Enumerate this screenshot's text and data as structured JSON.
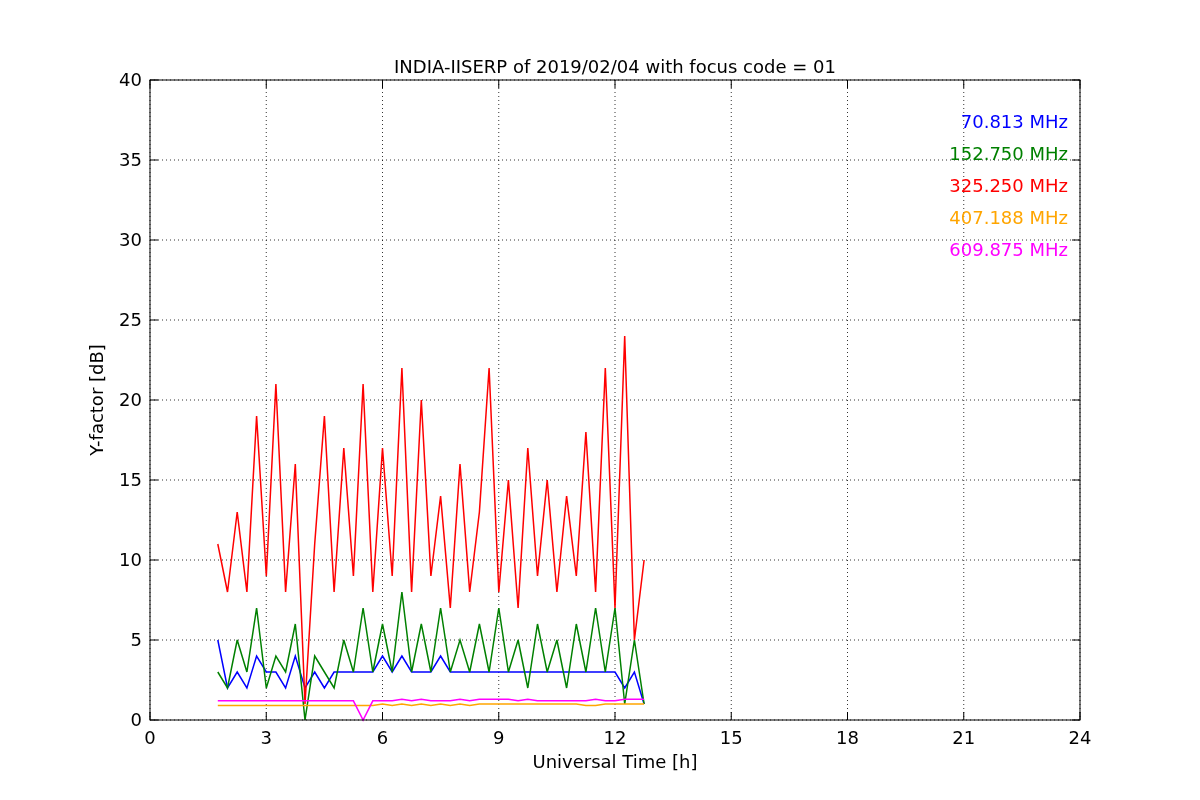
{
  "figure": {
    "chart_data": {
      "type": "line",
      "title": "INDIA-IISERP of 2019/02/04 with focus code = 01",
      "xlabel": "Universal Time [h]",
      "ylabel": "Y-factor [dB]",
      "xlim": [
        0,
        24
      ],
      "ylim": [
        0,
        40
      ],
      "xticks": [
        0,
        3,
        6,
        9,
        12,
        15,
        18,
        21,
        24
      ],
      "yticks": [
        0,
        5,
        10,
        15,
        20,
        25,
        30,
        35,
        40
      ],
      "grid": true,
      "x": [
        1.75,
        2,
        2.25,
        2.5,
        2.75,
        3,
        3.25,
        3.5,
        3.75,
        4,
        4.25,
        4.5,
        4.75,
        5,
        5.25,
        5.5,
        5.75,
        6,
        6.25,
        6.5,
        6.75,
        7,
        7.25,
        7.5,
        7.75,
        8,
        8.25,
        8.5,
        8.75,
        9,
        9.25,
        9.5,
        9.75,
        10,
        10.25,
        10.5,
        10.75,
        11,
        11.25,
        11.5,
        11.75,
        12,
        12.25,
        12.5,
        12.75
      ],
      "series": [
        {
          "name": "70.813 MHz",
          "color": "#0000ff",
          "values": [
            5,
            2,
            3,
            2,
            4,
            3,
            3,
            2,
            4,
            2,
            3,
            2,
            3,
            3,
            3,
            3,
            3,
            4,
            3,
            4,
            3,
            3,
            3,
            4,
            3,
            3,
            3,
            3,
            3,
            3,
            3,
            3,
            3,
            3,
            3,
            3,
            3,
            3,
            3,
            3,
            3,
            3,
            2,
            3,
            1
          ]
        },
        {
          "name": "152.750 MHz",
          "color": "#008000",
          "values": [
            3,
            2,
            5,
            3,
            7,
            2,
            4,
            3,
            6,
            0,
            4,
            3,
            2,
            5,
            3,
            7,
            3,
            6,
            3,
            8,
            3,
            6,
            3,
            7,
            3,
            5,
            3,
            6,
            3,
            7,
            3,
            5,
            2,
            6,
            3,
            5,
            2,
            6,
            3,
            7,
            3,
            7,
            1,
            5,
            1
          ]
        },
        {
          "name": "325.250 MHz",
          "color": "#ff0000",
          "values": [
            11,
            8,
            13,
            8,
            19,
            9,
            21,
            8,
            16,
            1,
            11,
            19,
            8,
            17,
            9,
            21,
            8,
            17,
            9,
            22,
            8,
            20,
            9,
            14,
            7,
            16,
            8,
            13,
            22,
            8,
            15,
            7,
            17,
            9,
            15,
            8,
            14,
            9,
            18,
            8,
            22,
            7,
            24,
            5,
            10
          ]
        },
        {
          "name": "407.188 MHz",
          "color": "#ffa500",
          "values": [
            0.9,
            0.9,
            0.9,
            0.9,
            0.9,
            0.9,
            0.9,
            0.9,
            0.9,
            0.9,
            0.9,
            0.9,
            0.9,
            0.9,
            0.9,
            0.9,
            0.9,
            1,
            0.9,
            1,
            0.9,
            1,
            0.9,
            1,
            0.9,
            1,
            0.9,
            1,
            1,
            1,
            1,
            1,
            1,
            1,
            1,
            1,
            1,
            1,
            0.9,
            0.9,
            1,
            1,
            1,
            1,
            1
          ]
        },
        {
          "name": "609.875 MHz",
          "color": "#ff00ff",
          "values": [
            1.2,
            1.2,
            1.2,
            1.2,
            1.2,
            1.2,
            1.2,
            1.2,
            1.2,
            1.2,
            1.2,
            1.2,
            1.2,
            1.2,
            1.2,
            0,
            1.2,
            1.2,
            1.2,
            1.3,
            1.2,
            1.3,
            1.2,
            1.2,
            1.2,
            1.3,
            1.2,
            1.3,
            1.3,
            1.3,
            1.3,
            1.2,
            1.3,
            1.2,
            1.2,
            1.2,
            1.2,
            1.2,
            1.2,
            1.3,
            1.2,
            1.2,
            1.3,
            1.3,
            1.3
          ]
        }
      ]
    }
  }
}
